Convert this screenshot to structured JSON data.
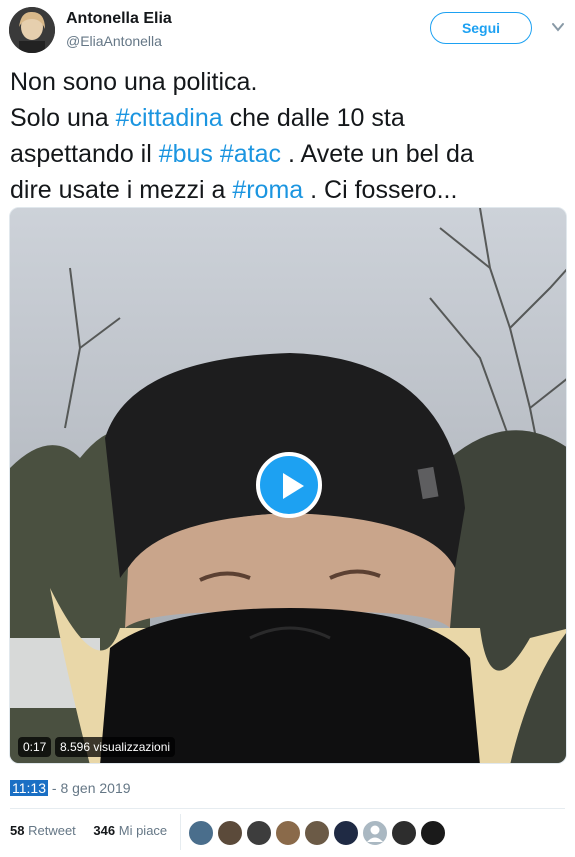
{
  "user": {
    "name": "Antonella Elia",
    "handle": "@EliaAntonella",
    "follow_label": "Segui"
  },
  "tweet": {
    "line1": "Non sono una politica.",
    "p_solo": "Solo una ",
    "tag_cittadina": "#cittadina",
    "p_dalle": " che dalle 10 sta",
    "p_aspettando": "aspettando il ",
    "tag_bus": "#bus",
    "tag_atac": "#atac",
    "p_avete": " . Avete un bel da",
    "p_dire": "dire usate i mezzi a ",
    "tag_roma": "#roma",
    "p_end": " . Ci fossero..."
  },
  "video": {
    "duration": "0:17",
    "views": "8.596 visualizzazioni"
  },
  "meta": {
    "time": "11:13",
    "date": " - 8 gen 2019"
  },
  "stats": {
    "retweets": "58",
    "retweets_label": "Retweet",
    "likes": "346",
    "likes_label": "Mi piace"
  },
  "likers": [
    {
      "icon": "liker-avatar-1",
      "color": "#4a6e8c"
    },
    {
      "icon": "liker-avatar-2",
      "color": "#5b4a3a"
    },
    {
      "icon": "liker-avatar-3",
      "color": "#3d3d3d"
    },
    {
      "icon": "liker-avatar-4",
      "color": "#8a6a4a"
    },
    {
      "icon": "liker-avatar-5",
      "color": "#6b5a46"
    },
    {
      "icon": "liker-avatar-6",
      "color": "#1f2a44"
    },
    {
      "icon": "liker-avatar-7",
      "color": "#aab8c2"
    },
    {
      "icon": "liker-avatar-8",
      "color": "#2d2d2d"
    },
    {
      "icon": "liker-avatar-9",
      "color": "#1a1a1a"
    }
  ]
}
